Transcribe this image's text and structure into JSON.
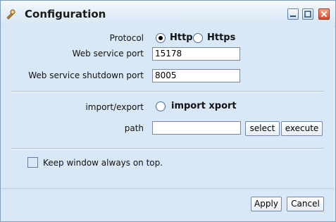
{
  "window": {
    "title": "Configuration",
    "icons": [
      "app-tool-icon",
      "minimize-icon",
      "maximize-icon",
      "close-icon"
    ]
  },
  "protocol": {
    "label": "Protocol",
    "options": [
      {
        "label": "Http",
        "selected": true
      },
      {
        "label": "Https",
        "selected": false
      }
    ]
  },
  "web_service_port": {
    "label": "Web service port",
    "value": "15178"
  },
  "shutdown_port": {
    "label": "Web service shutdown port",
    "value": "8005"
  },
  "import_export": {
    "label": "import/export",
    "option_label": "import xport",
    "selected": false
  },
  "path": {
    "label": "path",
    "value": "",
    "select_label": "select",
    "execute_label": "execute"
  },
  "always_on_top": {
    "label": "Keep window always on top.",
    "checked": false
  },
  "footer": {
    "apply_label": "Apply",
    "cancel_label": "Cancel"
  },
  "colors": {
    "background": "#d9e8f6",
    "close_button": "#d84a2a",
    "border": "#7f9db9"
  }
}
